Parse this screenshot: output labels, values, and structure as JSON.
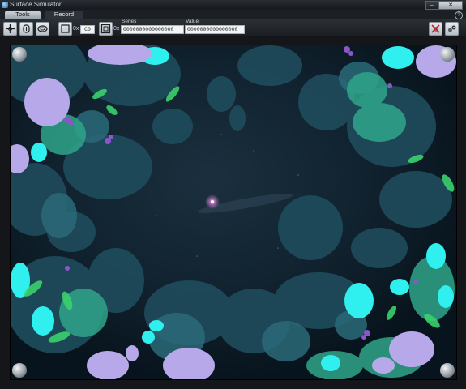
{
  "window": {
    "title": "Surface Simulator",
    "close_label": "✕"
  },
  "tabs": [
    {
      "label": "Tools",
      "active": true
    },
    {
      "label": "Record",
      "active": false
    }
  ],
  "help_label": "?",
  "toolbar": {
    "hex_prefix_1": "0x",
    "hex_prefix_2": "0x",
    "tag_value": "C0",
    "series_label": "Series",
    "series_value": "0000000000000000",
    "value_label": "Value",
    "value_value": "0000000000000000"
  },
  "colors": {
    "surface_bg": "#0d1f2c",
    "stone_dark": "#1f4a5c",
    "stone_teal": "#2c7d86",
    "glow_cyan": "#2ff0ee",
    "lavender": "#b4a8ea",
    "leaf_green": "#3ad26c"
  },
  "icons": [
    "contact-tool-icon",
    "finger-tool-icon",
    "blob-tool-icon",
    "tag-icon",
    "byte-tag-icon",
    "clear-contacts-icon",
    "settings-icon",
    "close-icon",
    "help-icon"
  ]
}
